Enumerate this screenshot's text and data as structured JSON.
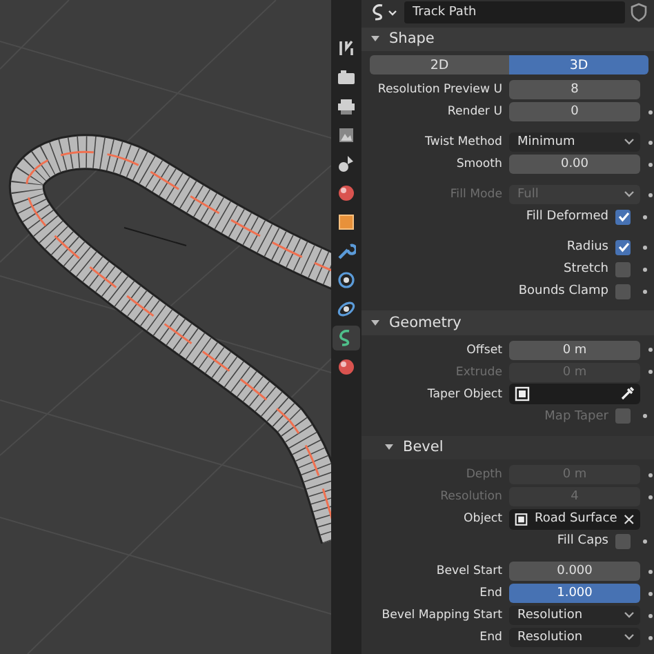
{
  "object_field": {
    "name": "Track Path"
  },
  "tabs": [
    {
      "kind": "tool",
      "selected": false
    },
    {
      "kind": "render",
      "selected": false
    },
    {
      "kind": "output",
      "selected": false
    },
    {
      "kind": "view_layer",
      "selected": false
    },
    {
      "kind": "scene",
      "selected": false
    },
    {
      "kind": "world",
      "selected": false
    },
    {
      "kind": "object",
      "selected": false
    },
    {
      "kind": "modifier",
      "selected": false
    },
    {
      "kind": "particles",
      "selected": false
    },
    {
      "kind": "physics",
      "selected": false
    },
    {
      "kind": "curve_data",
      "selected": true
    },
    {
      "kind": "material",
      "selected": false
    }
  ],
  "sections": [
    {
      "title": "Shape",
      "expanded": true,
      "subpanel": false,
      "rows": [
        {
          "kind": "toggle",
          "options": [
            {
              "label": "2D",
              "selected": false
            },
            {
              "label": "3D",
              "selected": true
            }
          ]
        },
        {
          "kind": "number",
          "label": "Resolution Preview U",
          "value": "8",
          "disabled": false,
          "animatable": false,
          "selected": false
        },
        {
          "kind": "number",
          "label": "Render U",
          "value": "0",
          "disabled": false,
          "animatable": true,
          "selected": false
        },
        {
          "kind": "spacer"
        },
        {
          "kind": "dropdown",
          "label": "Twist Method",
          "value": "Minimum",
          "disabled": false,
          "animatable": true
        },
        {
          "kind": "number",
          "label": "Smooth",
          "value": "0.00",
          "disabled": false,
          "animatable": true,
          "selected": false
        },
        {
          "kind": "spacer"
        },
        {
          "kind": "dropdown",
          "label": "Fill Mode",
          "value": "Full",
          "disabled": true,
          "animatable": true
        },
        {
          "kind": "checkbox",
          "label": "Fill Deformed",
          "checked": true,
          "disabled": false,
          "animatable": true
        },
        {
          "kind": "spacer"
        },
        {
          "kind": "checkbox",
          "label": "Radius",
          "checked": true,
          "disabled": false,
          "animatable": true
        },
        {
          "kind": "checkbox",
          "label": "Stretch",
          "checked": false,
          "disabled": false,
          "animatable": true
        },
        {
          "kind": "checkbox",
          "label": "Bounds Clamp",
          "checked": false,
          "disabled": false,
          "animatable": true
        }
      ]
    },
    {
      "title": "Geometry",
      "expanded": true,
      "subpanel": false,
      "rows": [
        {
          "kind": "number",
          "label": "Offset",
          "value": "0 m",
          "disabled": false,
          "animatable": true,
          "selected": false
        },
        {
          "kind": "number",
          "label": "Extrude",
          "value": "0 m",
          "disabled": true,
          "animatable": true,
          "selected": false
        },
        {
          "kind": "object",
          "label": "Taper Object",
          "disabled": false
        },
        {
          "kind": "checkbox",
          "label": "Map Taper",
          "checked": false,
          "disabled": true,
          "animatable": true
        }
      ]
    },
    {
      "title": "Bevel",
      "expanded": true,
      "subpanel": true,
      "rows": [
        {
          "kind": "number",
          "label": "Depth",
          "value": "0 m",
          "disabled": true,
          "animatable": true,
          "selected": false
        },
        {
          "kind": "number",
          "label": "Resolution",
          "value": "4",
          "disabled": true,
          "animatable": true,
          "selected": false
        },
        {
          "kind": "object",
          "label": "Object",
          "value": "Road Surface",
          "disabled": false
        },
        {
          "kind": "checkbox",
          "label": "Fill Caps",
          "checked": false,
          "disabled": false,
          "animatable": true
        },
        {
          "kind": "spacer"
        },
        {
          "kind": "number",
          "label": "Bevel Start",
          "value": "0.000",
          "disabled": false,
          "animatable": true,
          "selected": false
        },
        {
          "kind": "number",
          "label": "End",
          "value": "1.000",
          "disabled": false,
          "animatable": true,
          "selected": true
        },
        {
          "kind": "dropdown",
          "label": "Bevel Mapping Start",
          "value": "Resolution",
          "disabled": false,
          "animatable": true
        },
        {
          "kind": "dropdown",
          "label": "End",
          "value": "Resolution",
          "disabled": false,
          "animatable": true
        }
      ]
    }
  ]
}
